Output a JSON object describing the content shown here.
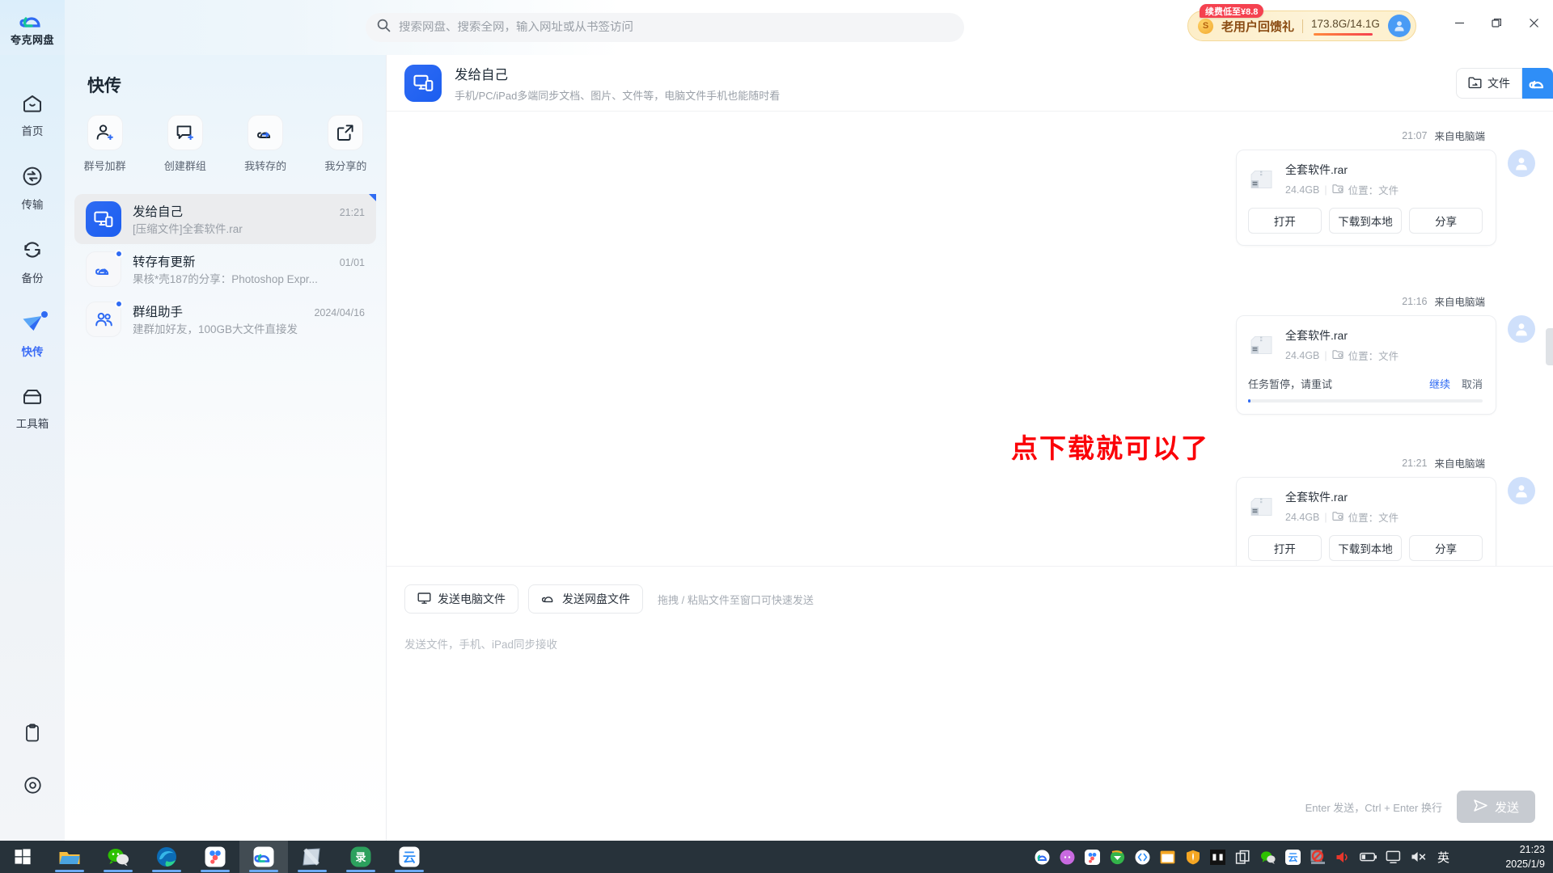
{
  "app": {
    "brand": "夸克网盘",
    "brand_icon": "quark-cloud-logo-icon"
  },
  "search": {
    "placeholder": "搜索网盘、搜索全网，输入网址或从书签访问",
    "icon": "search-icon",
    "value": ""
  },
  "promo": {
    "tag": "续费低至¥8.8",
    "coin_icon": "coin-icon",
    "label": "老用户回馈礼",
    "quota": "173.8G/14.1G",
    "avatar_icon": "user-avatar-icon"
  },
  "window_controls": {
    "minimize": "minimize-icon",
    "maximize": "restore-icon",
    "close": "close-icon"
  },
  "rail": {
    "items": [
      {
        "label": "首页",
        "icon": "home-icon",
        "active": false,
        "dot": false
      },
      {
        "label": "传输",
        "icon": "transfer-icon",
        "active": false,
        "dot": false
      },
      {
        "label": "备份",
        "icon": "backup-sync-icon",
        "active": false,
        "dot": false
      },
      {
        "label": "快传",
        "icon": "fast-send-icon",
        "active": true,
        "dot": true
      },
      {
        "label": "工具箱",
        "icon": "toolbox-icon",
        "active": false,
        "dot": false
      }
    ],
    "bottom_icons": [
      "clipboard-icon",
      "settings-gear-icon"
    ]
  },
  "conversation_panel": {
    "title": "快传",
    "quick_actions": [
      {
        "label": "群号加群",
        "icon": "add-user-icon"
      },
      {
        "label": "创建群组",
        "icon": "create-group-icon"
      },
      {
        "label": "我转存的",
        "icon": "saved-cloud-icon"
      },
      {
        "label": "我分享的",
        "icon": "share-external-icon"
      }
    ],
    "items": [
      {
        "name": "发给自己",
        "time": "21:21",
        "preview": "[压缩文件]全套软件.rar",
        "icon": "devices-sync-icon",
        "active": true,
        "badge": false
      },
      {
        "name": "转存有更新",
        "time": "01/01",
        "preview": "果核*壳187的分享：Photoshop Expr...",
        "icon": "saved-cloud-icon",
        "active": false,
        "badge": true
      },
      {
        "name": "群组助手",
        "time": "2024/04/16",
        "preview": "建群加好友，100GB大文件直接发",
        "icon": "group-users-icon",
        "active": false,
        "badge": true
      }
    ]
  },
  "chat": {
    "header": {
      "title": "发给自己",
      "subtitle": "手机/PC/iPad多端同步文档、图片、文件等，电脑文件手机也能随时看",
      "avatar_icon": "devices-sync-icon",
      "file_button": "文件",
      "file_button_icon": "folder-arrow-icon",
      "cloud_button_icon": "quark-cloud-icon"
    },
    "annotation": "点下载就可以了",
    "annotation_color": "#fb0007",
    "messages": [
      {
        "time": "21:07",
        "source": "来自电脑端",
        "file_name": "全套软件.rar",
        "file_size": "24.4GB",
        "location_icon": "folder-location-icon",
        "location": "位置：文件",
        "file_icon": "rar-archive-icon",
        "avatar_icon": "user-avatar-icon",
        "buttons": [
          "打开",
          "下载到本地",
          "分享"
        ]
      },
      {
        "time": "21:16",
        "source": "来自电脑端",
        "file_name": "全套软件.rar",
        "file_size": "24.4GB",
        "location_icon": "folder-location-icon",
        "location": "位置：文件",
        "file_icon": "rar-archive-icon",
        "avatar_icon": "user-avatar-icon",
        "status": "任务暂停，请重试",
        "resume_label": "继续",
        "cancel_label": "取消",
        "progress_percent": 1
      },
      {
        "time": "21:21",
        "source": "来自电脑端",
        "file_name": "全套软件.rar",
        "file_size": "24.4GB",
        "location_icon": "folder-location-icon",
        "location": "位置：文件",
        "file_icon": "rar-archive-icon",
        "avatar_icon": "user-avatar-icon",
        "buttons": [
          "打开",
          "下载到本地",
          "分享"
        ]
      }
    ]
  },
  "composer": {
    "send_pc_file": "发送电脑文件",
    "send_pc_file_icon": "monitor-icon",
    "send_cloud_file": "发送网盘文件",
    "send_cloud_file_icon": "cloud-icon",
    "drag_hint": "拖拽 / 粘贴文件至窗口可快速发送",
    "input_placeholder": "发送文件，手机、iPad同步接收",
    "keys_hint": "Enter 发送，Ctrl + Enter 换行",
    "send_label": "发送",
    "send_icon": "send-plane-icon"
  },
  "taskbar": {
    "start_icon": "windows-start-icon",
    "pinned": [
      {
        "icon": "file-explorer-icon",
        "open": true
      },
      {
        "icon": "wechat-icon",
        "open": true
      },
      {
        "icon": "edge-browser-icon",
        "open": true
      },
      {
        "icon": "baidu-netdisk-icon",
        "open": true
      },
      {
        "icon": "quark-netdisk-icon",
        "open": true,
        "focus": true
      },
      {
        "icon": "notepad-icon",
        "open": true
      },
      {
        "icon": "recorder-icon",
        "open": true
      },
      {
        "icon": "wps-cloud-icon",
        "open": true
      }
    ],
    "tray": [
      "quark-tray-icon",
      "cat-app-icon",
      "baidu-tray-icon",
      "idm-icon",
      "vscode-icon",
      "window-app-icon",
      "firewall-shield-icon",
      "dark-app-icon",
      "copy-icon",
      "wechat-tray-icon",
      "wps-tray-icon",
      "block-icon",
      "volume-red-icon",
      "battery-icon",
      "display-icon",
      "mute-icon"
    ],
    "ime": "英",
    "clock_time": "21:23",
    "clock_date": "2025/1/9"
  }
}
